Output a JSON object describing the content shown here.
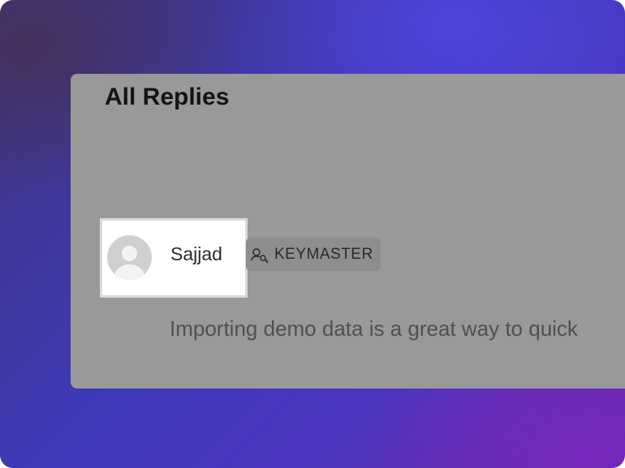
{
  "section": {
    "title": "All Replies"
  },
  "reply": {
    "author_name": "Sajjad",
    "role_icon": "keymaster-icon",
    "role_label": "KEYMASTER",
    "text": "Importing demo data is a great way to quick"
  },
  "colors": {
    "card_background": "#999999",
    "highlight_background": "#ffffff",
    "badge_background": "#8e8e8e"
  }
}
